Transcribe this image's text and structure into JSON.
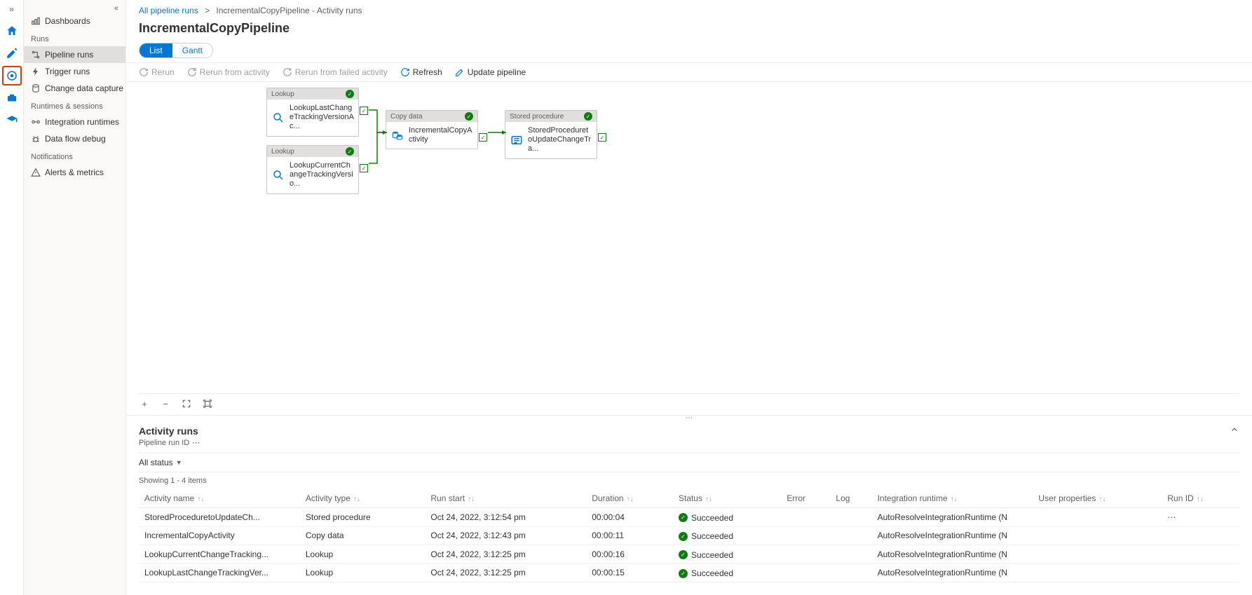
{
  "rail": {
    "items": [
      {
        "name": "home-icon",
        "color": "#0078d4"
      },
      {
        "name": "pencil-icon",
        "color": "#0078d4"
      },
      {
        "name": "monitor-icon",
        "color": "#0078d4",
        "active": true
      },
      {
        "name": "toolbox-icon",
        "color": "#0078d4"
      },
      {
        "name": "graduation-icon",
        "color": "#0078d4"
      }
    ]
  },
  "sidebar": {
    "dashboards_label": "Dashboards",
    "runs_label": "Runs",
    "pipeline_runs": "Pipeline runs",
    "trigger_runs": "Trigger runs",
    "cdc": "Change data capture (previ...",
    "runtimes_label": "Runtimes & sessions",
    "integration_runtimes": "Integration runtimes",
    "dataflow_debug": "Data flow debug",
    "notifications_label": "Notifications",
    "alerts_metrics": "Alerts & metrics"
  },
  "breadcrumb": {
    "root": "All pipeline runs",
    "current": "IncrementalCopyPipeline - Activity runs"
  },
  "page_title": "IncrementalCopyPipeline",
  "tabs": {
    "list": "List",
    "gantt": "Gantt"
  },
  "toolbar": {
    "rerun": "Rerun",
    "rerun_from_activity": "Rerun from activity",
    "rerun_from_failed": "Rerun from failed activity",
    "refresh": "Refresh",
    "update_pipeline": "Update pipeline"
  },
  "nodes": {
    "lookup1": {
      "header": "Lookup",
      "title": "LookupLastChangeTrackingVersionAc..."
    },
    "lookup2": {
      "header": "Lookup",
      "title": "LookupCurrentChangeTrackingVersio..."
    },
    "copy": {
      "header": "Copy data",
      "title": "IncrementalCopyActivity"
    },
    "sproc": {
      "header": "Stored procedure",
      "title": "StoredProceduretoUpdateChangeTra..."
    }
  },
  "activity_runs": {
    "title": "Activity runs",
    "label_pipeline_run_id": "Pipeline run ID",
    "filter": "All status",
    "paging": "Showing 1 - 4 items",
    "headers": [
      "Activity name",
      "Activity type",
      "Run start",
      "Duration",
      "Status",
      "Error",
      "Log",
      "Integration runtime",
      "User properties",
      "Run ID"
    ],
    "rows": [
      {
        "name": "StoredProceduretoUpdateCh...",
        "type": "Stored procedure",
        "start": "Oct 24, 2022, 3:12:54 pm",
        "duration": "00:00:04",
        "status": "Succeeded",
        "ir": "AutoResolveIntegrationRuntime (N"
      },
      {
        "name": "IncrementalCopyActivity",
        "type": "Copy data",
        "start": "Oct 24, 2022, 3:12:43 pm",
        "duration": "00:00:11",
        "status": "Succeeded",
        "ir": "AutoResolveIntegrationRuntime (N"
      },
      {
        "name": "LookupCurrentChangeTracking...",
        "type": "Lookup",
        "start": "Oct 24, 2022, 3:12:25 pm",
        "duration": "00:00:16",
        "status": "Succeeded",
        "ir": "AutoResolveIntegrationRuntime (N"
      },
      {
        "name": "LookupLastChangeTrackingVer...",
        "type": "Lookup",
        "start": "Oct 24, 2022, 3:12:25 pm",
        "duration": "00:00:15",
        "status": "Succeeded",
        "ir": "AutoResolveIntegrationRuntime (N"
      }
    ]
  }
}
